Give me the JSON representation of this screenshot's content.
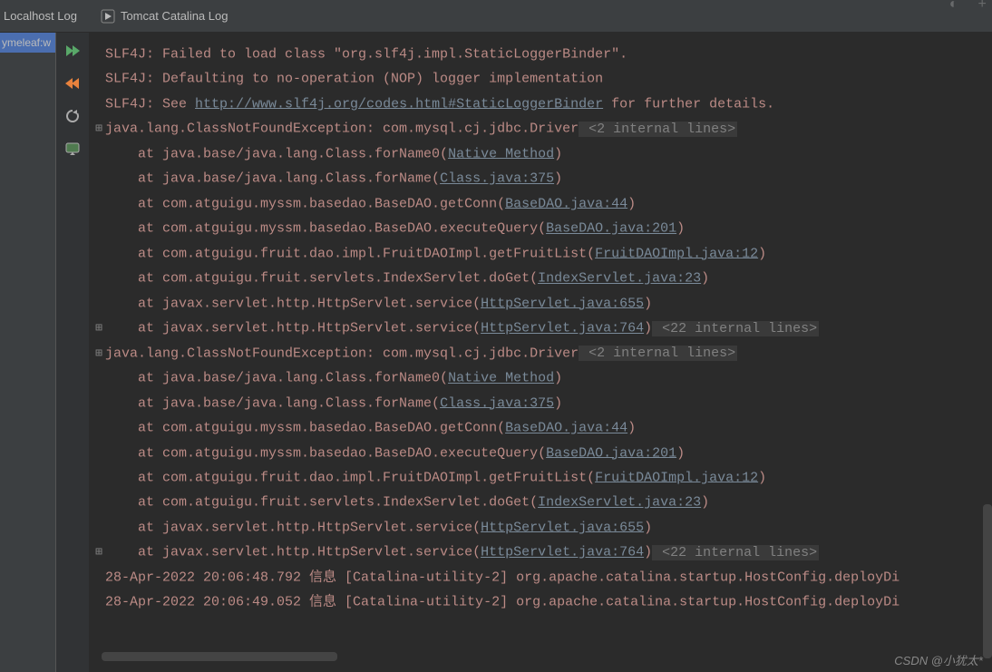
{
  "tabs": {
    "localhost": "Localhost Log",
    "catalina": "Tomcat Catalina Log"
  },
  "tree": {
    "item0": "ymeleaf:w"
  },
  "watermark": "CSDN @小犹太*",
  "console": {
    "l0": "SLF4J: Failed to load class \"org.slf4j.impl.StaticLoggerBinder\".",
    "l1": "SLF4J: Defaulting to no-operation (NOP) logger implementation",
    "l2a": "SLF4J: See ",
    "l2link": "http://www.slf4j.org/codes.html#StaticLoggerBinder",
    "l2b": " for further details.",
    "l3a": "java.lang.ClassNotFoundException: com.mysql.cj.jdbc.Driver",
    "l3dim": " <2 internal lines>",
    "l4a": "    at java.base/java.lang.Class.forName0(",
    "l4link": "Native Method",
    "l4b": ")",
    "l5a": "    at java.base/java.lang.Class.forName(",
    "l5link": "Class.java:375",
    "l5b": ")",
    "l6a": "    at com.atguigu.myssm.basedao.BaseDAO.getConn(",
    "l6link": "BaseDAO.java:44",
    "l6b": ")",
    "l7a": "    at com.atguigu.myssm.basedao.BaseDAO.executeQuery(",
    "l7link": "BaseDAO.java:201",
    "l7b": ")",
    "l8a": "    at com.atguigu.fruit.dao.impl.FruitDAOImpl.getFruitList(",
    "l8link": "FruitDAOImpl.java:12",
    "l8b": ")",
    "l9a": "    at com.atguigu.fruit.servlets.IndexServlet.doGet(",
    "l9link": "IndexServlet.java:23",
    "l9b": ")",
    "l10a": "    at javax.servlet.http.HttpServlet.service(",
    "l10link": "HttpServlet.java:655",
    "l10b": ")",
    "l11a": "    at javax.servlet.http.HttpServlet.service(",
    "l11link": "HttpServlet.java:764",
    "l11b": ")",
    "l11dim": " <22 internal lines>",
    "l12a": "java.lang.ClassNotFoundException: com.mysql.cj.jdbc.Driver",
    "l12dim": " <2 internal lines>",
    "l13a": "    at java.base/java.lang.Class.forName0(",
    "l13link": "Native Method",
    "l13b": ")",
    "l14a": "    at java.base/java.lang.Class.forName(",
    "l14link": "Class.java:375",
    "l14b": ")",
    "l15a": "    at com.atguigu.myssm.basedao.BaseDAO.getConn(",
    "l15link": "BaseDAO.java:44",
    "l15b": ")",
    "l16a": "    at com.atguigu.myssm.basedao.BaseDAO.executeQuery(",
    "l16link": "BaseDAO.java:201",
    "l16b": ")",
    "l17a": "    at com.atguigu.fruit.dao.impl.FruitDAOImpl.getFruitList(",
    "l17link": "FruitDAOImpl.java:12",
    "l17b": ")",
    "l18a": "    at com.atguigu.fruit.servlets.IndexServlet.doGet(",
    "l18link": "IndexServlet.java:23",
    "l18b": ")",
    "l19a": "    at javax.servlet.http.HttpServlet.service(",
    "l19link": "HttpServlet.java:655",
    "l19b": ")",
    "l20a": "    at javax.servlet.http.HttpServlet.service(",
    "l20link": "HttpServlet.java:764",
    "l20b": ")",
    "l20dim": " <22 internal lines>",
    "l21": "28-Apr-2022 20:06:48.792 信息 [Catalina-utility-2] org.apache.catalina.startup.HostConfig.deployDi",
    "l22": "28-Apr-2022 20:06:49.052 信息 [Catalina-utility-2] org.apache.catalina.startup.HostConfig.deployDi"
  }
}
